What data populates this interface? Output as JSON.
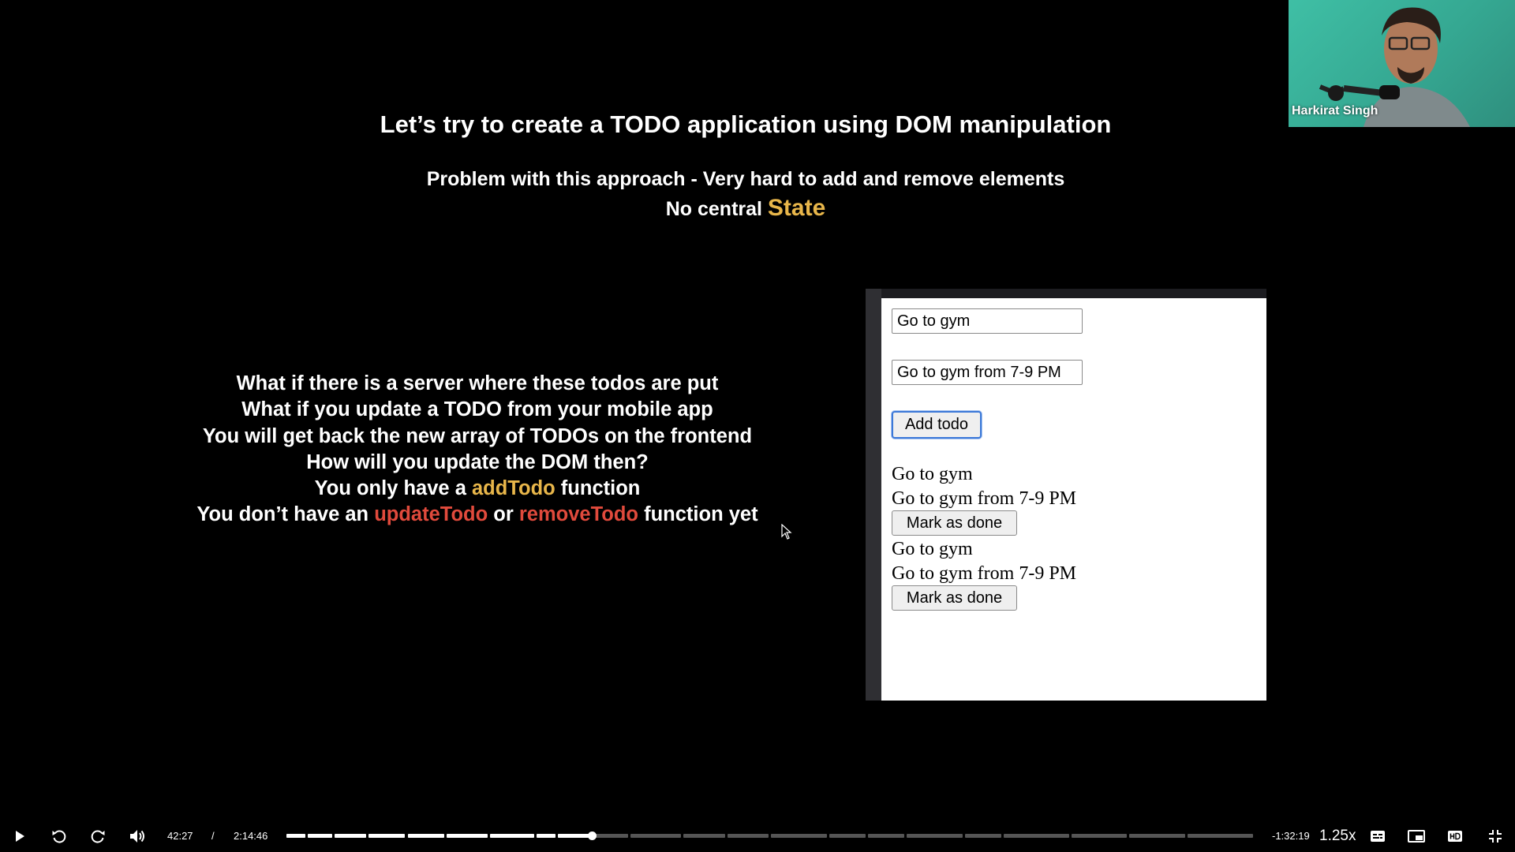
{
  "slide": {
    "title": "Let’s try to create a TODO application using DOM manipulation",
    "problem": "Problem with this approach - Very hard to add and remove elements",
    "central_prefix": "No central ",
    "central_state": "State",
    "lines": {
      "l1": "What if there is a server where these todos are put",
      "l2": "What if you update a TODO from your mobile app",
      "l3": "You will get back the new array of TODOs on the frontend",
      "l4": "How will you update the DOM then?",
      "l5_pre": "You only have a ",
      "l5_hl": "addTodo",
      "l5_post": " function",
      "l6_pre": "You don’t have an ",
      "l6_hl1": "updateTodo",
      "l6_mid": " or ",
      "l6_hl2": "removeTodo",
      "l6_post": " function yet"
    },
    "colors": {
      "highlight_yellow": "#e8b64a",
      "highlight_red": "#e04a3c"
    }
  },
  "demo": {
    "title_input_value": "Go to gym",
    "description_input_value": "Go to gym from 7-9 PM",
    "add_button_label": "Add todo",
    "todos": [
      {
        "title": "Go to gym",
        "description": "Go to gym from 7-9 PM",
        "button_label": "Mark as done"
      },
      {
        "title": "Go to gym",
        "description": "Go to gym from 7-9 PM",
        "button_label": "Mark as done"
      }
    ]
  },
  "webcam": {
    "name": "Harkirat Singh"
  },
  "player": {
    "current_time": "42:27",
    "separator": "/",
    "duration": "2:14:46",
    "remaining": "-1:32:19",
    "speed": "1.25x",
    "progress_fraction": 0.315,
    "icons": [
      "play-icon",
      "rewind-icon",
      "forward-icon",
      "volume-icon",
      "captions-icon",
      "picture-in-picture-icon",
      "hd-icon",
      "fullscreen-exit-icon"
    ]
  }
}
